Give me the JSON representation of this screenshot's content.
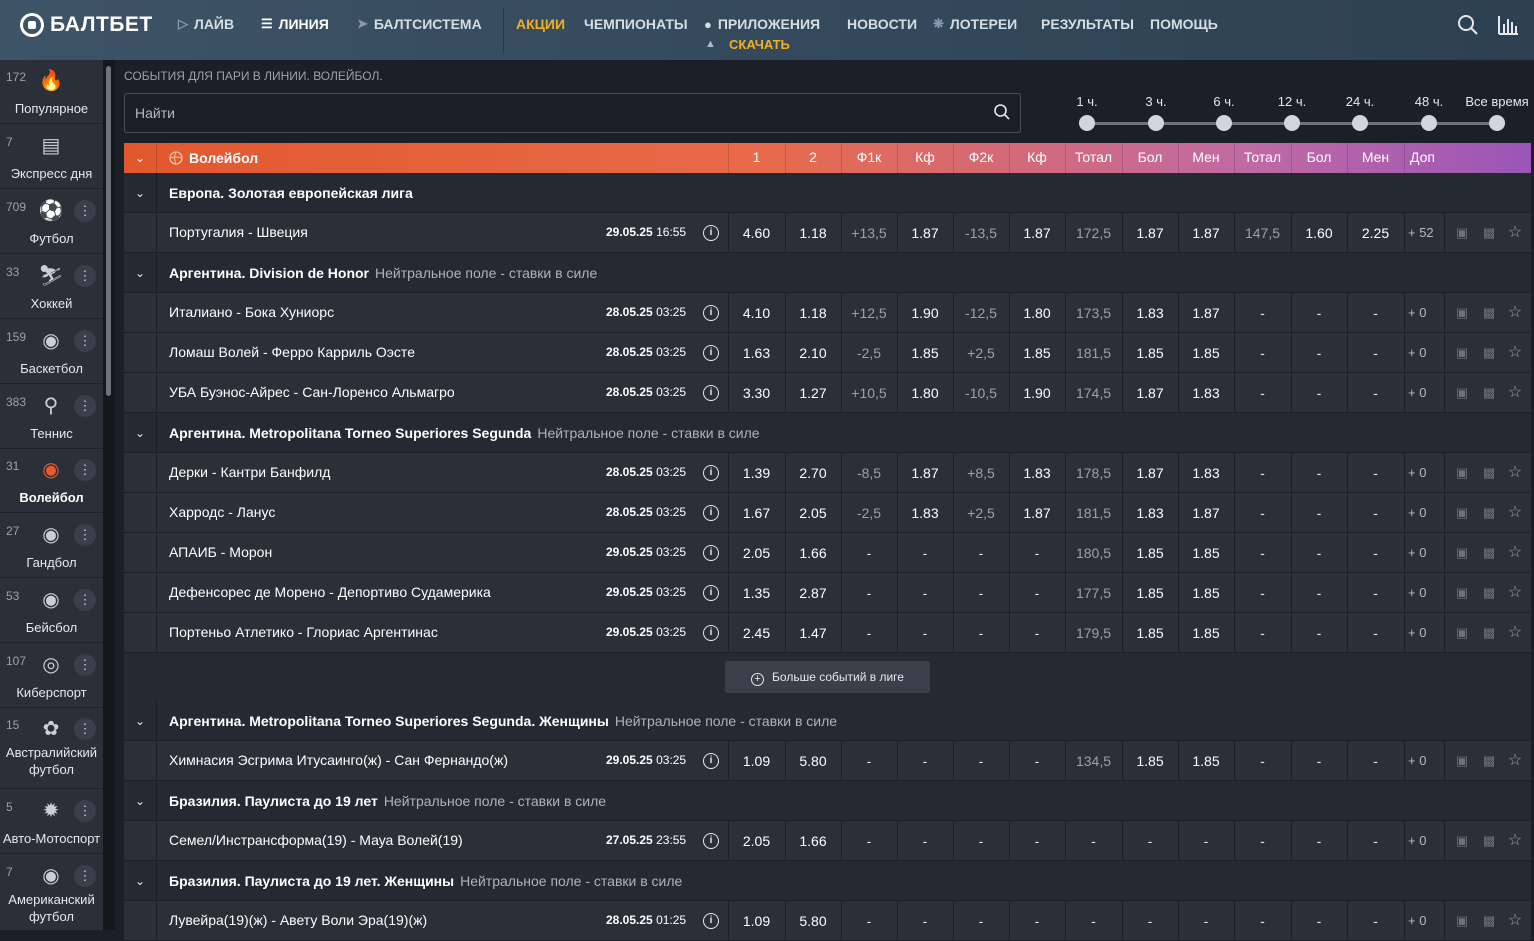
{
  "header": {
    "logo_text": "БАЛТБЕТ",
    "nav": [
      {
        "label": "ЛАЙВ",
        "icon": "play-circle-icon"
      },
      {
        "label": "ЛИНИЯ",
        "icon": "list-icon"
      },
      {
        "label": "БАЛТСИСТЕМА",
        "icon": "rocket-icon"
      },
      {
        "label": "АКЦИИ"
      },
      {
        "label": "ЧЕМПИОНАТЫ"
      },
      {
        "label": "ПРИЛОЖЕНИЯ",
        "icon": "apple-icon"
      },
      {
        "label": "НОВОСТИ"
      },
      {
        "label": "ЛОТЕРЕИ",
        "icon": "sparkle-icon"
      },
      {
        "label": "РЕЗУЛЬТАТЫ"
      },
      {
        "label": "ПОМОЩЬ"
      }
    ],
    "download_label": "СКАЧАТЬ",
    "promo_color": "#f2b01e"
  },
  "sidebar": {
    "items": [
      {
        "count": "172",
        "label": "Популярное",
        "icon": "fire-icon"
      },
      {
        "count": "7",
        "label": "Экспресс дня",
        "icon": "ticket-icon"
      },
      {
        "count": "709",
        "label": "Футбол",
        "icon": "football-icon"
      },
      {
        "count": "33",
        "label": "Хоккей",
        "icon": "hockey-icon"
      },
      {
        "count": "159",
        "label": "Баскетбол",
        "icon": "basketball-icon"
      },
      {
        "count": "383",
        "label": "Теннис",
        "icon": "tennis-icon"
      },
      {
        "count": "31",
        "label": "Волейбол",
        "icon": "volleyball-icon"
      },
      {
        "count": "27",
        "label": "Гандбол",
        "icon": "handball-icon"
      },
      {
        "count": "53",
        "label": "Бейсбол",
        "icon": "baseball-icon"
      },
      {
        "count": "107",
        "label": "Киберспорт",
        "icon": "esports-icon"
      },
      {
        "count": "15",
        "label": "Австралийский футбол",
        "icon": "aussie-football-icon"
      },
      {
        "count": "5",
        "label": "Авто-Мотоспорт",
        "icon": "wheel-icon"
      },
      {
        "count": "7",
        "label": "Американский футбол",
        "icon": "american-football-icon"
      }
    ]
  },
  "main": {
    "breadcrumb": "СОБЫТИЯ ДЛЯ ПАРИ В ЛИНИИ. ВОЛЕЙБОЛ.",
    "search_placeholder": "Найти",
    "time_filters": [
      "1 ч.",
      "3 ч.",
      "6 ч.",
      "12 ч.",
      "24 ч.",
      "48 ч.",
      "Все время"
    ],
    "sport_name": "Волейбол",
    "columns": [
      "1",
      "2",
      "Ф1к",
      "Кф",
      "Ф2к",
      "Кф",
      "Тотал",
      "Бол",
      "Мен",
      "Тотал",
      "Бол",
      "Мен",
      "Доп"
    ],
    "more_events_label": "Больше событий в лиге",
    "accent_color": "#e2582e"
  },
  "leagues": [
    {
      "name": "Европа. Золотая европейская лига",
      "note": "",
      "events": [
        {
          "name": "Португалия - Швеция",
          "date": "29.05.25",
          "time": "16:55",
          "cells": [
            "4.60",
            "1.18",
            "+13,5",
            "1.87",
            "-13,5",
            "1.87",
            "172,5",
            "1.87",
            "1.87",
            "147,5",
            "1.60",
            "2.25",
            "+ 52"
          ]
        }
      ]
    },
    {
      "name": "Аргентина. Division de Honor",
      "note": "Нейтральное поле - ставки в силе",
      "events": [
        {
          "name": "Италиано - Бока Хуниорс",
          "date": "28.05.25",
          "time": "03:25",
          "cells": [
            "4.10",
            "1.18",
            "+12,5",
            "1.90",
            "-12,5",
            "1.80",
            "173,5",
            "1.83",
            "1.87",
            "-",
            "-",
            "-",
            "+ 0"
          ]
        },
        {
          "name": "Ломаш Волей - Ферро Карриль Оэсте",
          "date": "28.05.25",
          "time": "03:25",
          "cells": [
            "1.63",
            "2.10",
            "-2,5",
            "1.85",
            "+2,5",
            "1.85",
            "181,5",
            "1.85",
            "1.85",
            "-",
            "-",
            "-",
            "+ 0"
          ]
        },
        {
          "name": "УБА Буэнос-Айрес - Сан-Лоренсо Альмагро",
          "date": "28.05.25",
          "time": "03:25",
          "cells": [
            "3.30",
            "1.27",
            "+10,5",
            "1.80",
            "-10,5",
            "1.90",
            "174,5",
            "1.87",
            "1.83",
            "-",
            "-",
            "-",
            "+ 0"
          ]
        }
      ]
    },
    {
      "name": "Аргентина. Metropolitana Torneo Superiores Segunda",
      "note": "Нейтральное поле - ставки в силе",
      "more": true,
      "events": [
        {
          "name": "Дерки - Кантри Банфилд",
          "date": "28.05.25",
          "time": "03:25",
          "cells": [
            "1.39",
            "2.70",
            "-8,5",
            "1.87",
            "+8,5",
            "1.83",
            "178,5",
            "1.87",
            "1.83",
            "-",
            "-",
            "-",
            "+ 0"
          ]
        },
        {
          "name": "Харродс - Ланус",
          "date": "28.05.25",
          "time": "03:25",
          "cells": [
            "1.67",
            "2.05",
            "-2,5",
            "1.83",
            "+2,5",
            "1.87",
            "181,5",
            "1.83",
            "1.87",
            "-",
            "-",
            "-",
            "+ 0"
          ]
        },
        {
          "name": "АПАИБ - Морон",
          "date": "29.05.25",
          "time": "03:25",
          "cells": [
            "2.05",
            "1.66",
            "-",
            "-",
            "-",
            "-",
            "180,5",
            "1.85",
            "1.85",
            "-",
            "-",
            "-",
            "+ 0"
          ]
        },
        {
          "name": "Дефенсорес де Морено - Депортиво Судамерика",
          "date": "29.05.25",
          "time": "03:25",
          "cells": [
            "1.35",
            "2.87",
            "-",
            "-",
            "-",
            "-",
            "177,5",
            "1.85",
            "1.85",
            "-",
            "-",
            "-",
            "+ 0"
          ]
        },
        {
          "name": "Портеньо Атлетико - Глориас Аргентинас",
          "date": "29.05.25",
          "time": "03:25",
          "cells": [
            "2.45",
            "1.47",
            "-",
            "-",
            "-",
            "-",
            "179,5",
            "1.85",
            "1.85",
            "-",
            "-",
            "-",
            "+ 0"
          ]
        }
      ]
    },
    {
      "name": "Аргентина. Metropolitana Torneo Superiores Segunda. Женщины",
      "note": "Нейтральное поле - ставки в силе",
      "events": [
        {
          "name": "Химнасия Эсгрима Итусаинго(ж) - Сан Фернандо(ж)",
          "date": "29.05.25",
          "time": "03:25",
          "cells": [
            "1.09",
            "5.80",
            "-",
            "-",
            "-",
            "-",
            "134,5",
            "1.85",
            "1.85",
            "-",
            "-",
            "-",
            "+ 0"
          ]
        }
      ]
    },
    {
      "name": "Бразилия. Паулиста до 19 лет",
      "note": "Нейтральное поле - ставки в силе",
      "events": [
        {
          "name": "Семел/Инстрансформа(19) - Мауа Волей(19)",
          "date": "27.05.25",
          "time": "23:55",
          "cells": [
            "2.05",
            "1.66",
            "-",
            "-",
            "-",
            "-",
            "-",
            "-",
            "-",
            "-",
            "-",
            "-",
            "+ 0"
          ]
        }
      ]
    },
    {
      "name": "Бразилия. Паулиста до 19 лет. Женщины",
      "note": "Нейтральное поле - ставки в силе",
      "events": [
        {
          "name": "Лувейра(19)(ж) - Авету Воли Эра(19)(ж)",
          "date": "28.05.25",
          "time": "01:25",
          "cells": [
            "1.09",
            "5.80",
            "-",
            "-",
            "-",
            "-",
            "-",
            "-",
            "-",
            "-",
            "-",
            "-",
            "+ 0"
          ]
        }
      ]
    }
  ]
}
